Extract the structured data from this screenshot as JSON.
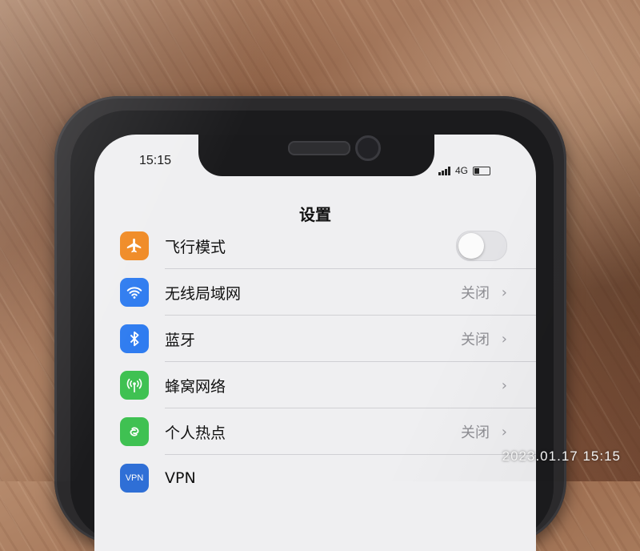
{
  "status_bar": {
    "time": "15:15",
    "network": "4G"
  },
  "nav": {
    "title": "设置"
  },
  "settings": [
    {
      "label": "飞行模式",
      "value": "",
      "icon": "airplane-icon",
      "control": "toggle-off"
    },
    {
      "label": "无线局域网",
      "value": "关闭",
      "icon": "wifi-icon",
      "control": "chevron"
    },
    {
      "label": "蓝牙",
      "value": "关闭",
      "icon": "bluetooth-icon",
      "control": "chevron"
    },
    {
      "label": "蜂窝网络",
      "value": "",
      "icon": "cellular-icon",
      "control": "chevron"
    },
    {
      "label": "个人热点",
      "value": "关闭",
      "icon": "hotspot-icon",
      "control": "chevron"
    },
    {
      "label": "VPN",
      "value": "",
      "icon": "vpn-icon",
      "control": "chevron"
    }
  ],
  "vpn_badge": "VPN",
  "chevron_glyph": "›",
  "photo_timestamp": "2023.01.17 15:15",
  "colors": {
    "airplane_icon_bg": "#f08a24",
    "wifi_icon_bg": "#2f7cf0",
    "bluetooth_icon_bg": "#2f7cf0",
    "cellular_icon_bg": "#3fc152",
    "hotspot_icon_bg": "#3fc152",
    "vpn_icon_bg": "#2f6fd6"
  }
}
